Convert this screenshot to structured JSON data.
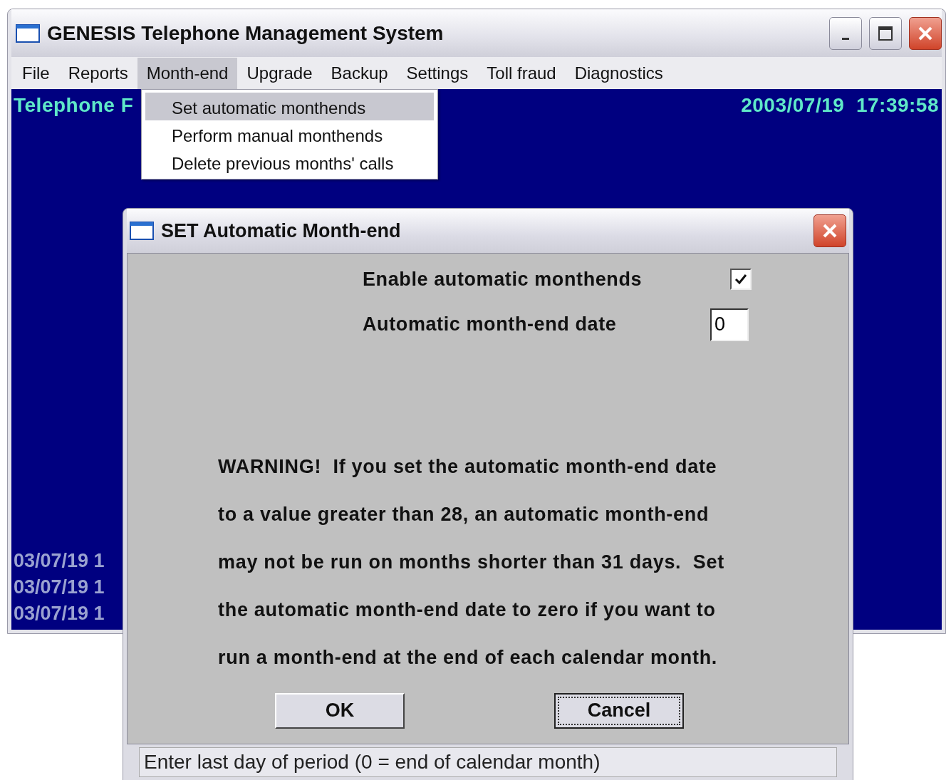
{
  "window": {
    "title": "GENESIS Telephone Management System"
  },
  "menu": [
    {
      "label": "File",
      "selected": false
    },
    {
      "label": "Reports",
      "selected": false
    },
    {
      "label": "Month-end",
      "selected": true
    },
    {
      "label": "Upgrade",
      "selected": false
    },
    {
      "label": "Backup",
      "selected": false
    },
    {
      "label": "Settings",
      "selected": false
    },
    {
      "label": "Toll fraud",
      "selected": false
    },
    {
      "label": "Diagnostics",
      "selected": false
    }
  ],
  "dropdown": [
    {
      "label": "Set automatic monthends",
      "selected": true
    },
    {
      "label": "Perform manual monthends",
      "selected": false
    },
    {
      "label": "Delete previous months' calls",
      "selected": false
    }
  ],
  "screen": {
    "heading": "Telephone F",
    "datetime": "2003/07/19  17:39:58",
    "log_lines": [
      "03/07/19 1",
      "03/07/19 1",
      "03/07/19 1"
    ]
  },
  "dialog": {
    "title": "SET Automatic Month-end",
    "fields": [
      {
        "kind": "checkbox",
        "label": "Enable automatic monthends",
        "checked": true
      },
      {
        "kind": "text",
        "label": "Automatic month-end date",
        "value": "0"
      }
    ],
    "warning_lines": [
      "WARNING!  If you set the automatic month-end date",
      "to a value greater than 28, an automatic month-end",
      "may not be run on months shorter than 31 days.  Set",
      "the automatic month-end date to zero if you want to",
      "run a month-end at the end of each calendar month."
    ],
    "buttons": [
      {
        "label": "OK",
        "focused": false
      },
      {
        "label": "Cancel",
        "focused": true
      }
    ],
    "status": "Enter last day of period (0 = end of calendar month)"
  }
}
